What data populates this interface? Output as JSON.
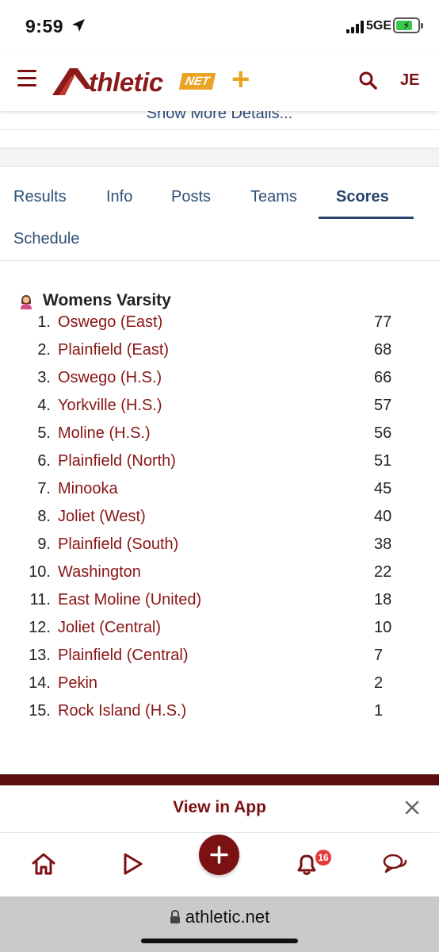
{
  "status_bar": {
    "time": "9:59",
    "network": "5GE"
  },
  "header": {
    "logo_text": "thletic",
    "logo_net": "NET",
    "logo_plus": "+",
    "user_initials": "JE",
    "brand_color": "#7b1113",
    "accent_color": "#e9a426"
  },
  "show_more": {
    "label": "Show More Details..."
  },
  "tabs": [
    {
      "label": "Results"
    },
    {
      "label": "Info"
    },
    {
      "label": "Posts"
    },
    {
      "label": "Teams"
    },
    {
      "label": "Scores",
      "active": true
    },
    {
      "label": "Schedule"
    }
  ],
  "scores": {
    "section_title": "Womens Varsity",
    "rows": [
      {
        "rank": "1.",
        "team": "Oswego (East)",
        "points": "77"
      },
      {
        "rank": "2.",
        "team": "Plainfield (East)",
        "points": "68"
      },
      {
        "rank": "3.",
        "team": "Oswego (H.S.)",
        "points": "66"
      },
      {
        "rank": "4.",
        "team": "Yorkville (H.S.)",
        "points": "57"
      },
      {
        "rank": "5.",
        "team": "Moline (H.S.)",
        "points": "56"
      },
      {
        "rank": "6.",
        "team": "Plainfield (North)",
        "points": "51"
      },
      {
        "rank": "7.",
        "team": "Minooka",
        "points": "45"
      },
      {
        "rank": "8.",
        "team": "Joliet (West)",
        "points": "40"
      },
      {
        "rank": "9.",
        "team": "Plainfield (South)",
        "points": "38"
      },
      {
        "rank": "10.",
        "team": "Washington",
        "points": "22"
      },
      {
        "rank": "11.",
        "team": "East Moline (United)",
        "points": "18"
      },
      {
        "rank": "12.",
        "team": "Joliet (Central)",
        "points": "10"
      },
      {
        "rank": "13.",
        "team": "Plainfield (Central)",
        "points": "7"
      },
      {
        "rank": "14.",
        "team": "Pekin",
        "points": "2"
      },
      {
        "rank": "15.",
        "team": "Rock Island (H.S.)",
        "points": "1"
      }
    ]
  },
  "app_banner": {
    "label": "View in App"
  },
  "bottom_nav": {
    "notification_count": "16",
    "items": [
      "home-icon",
      "play-icon",
      "add-icon",
      "bell-icon",
      "chat-icon"
    ]
  },
  "browser": {
    "url": "athletic.net"
  }
}
